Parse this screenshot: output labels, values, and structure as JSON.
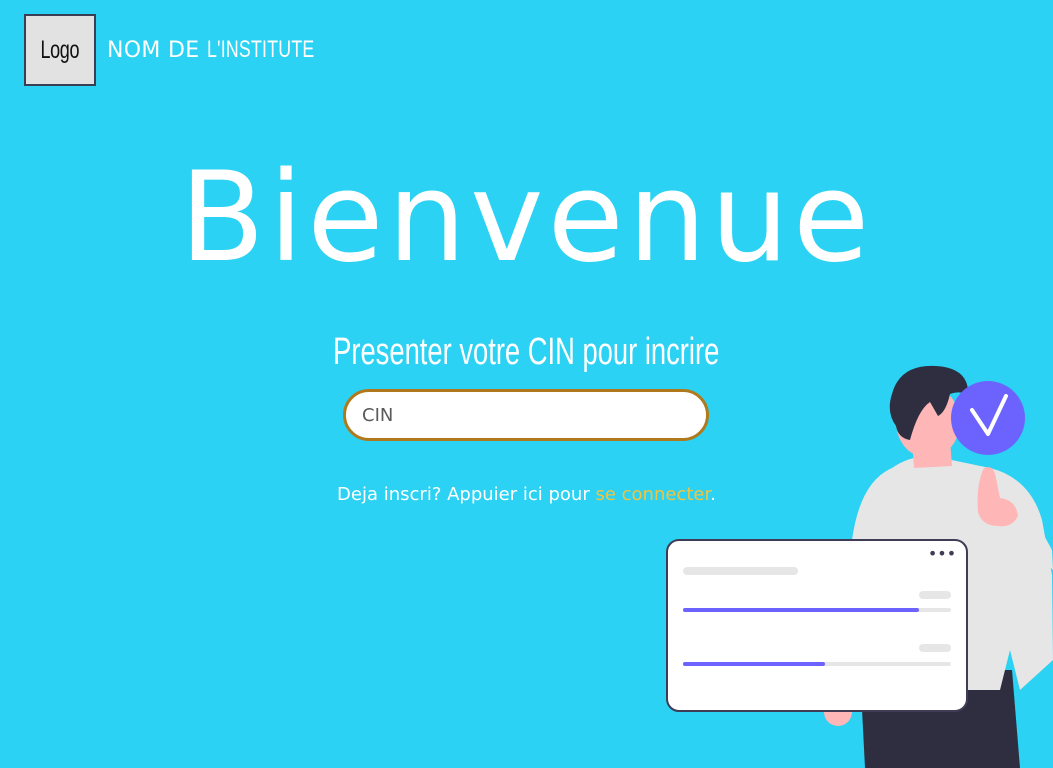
{
  "header": {
    "logo_label": "Logo",
    "institute_name_prefix": "NOM DE",
    "institute_name_suffix": "L'INSTITUTE"
  },
  "main": {
    "title": "Bienvenue",
    "subtitle": "Presenter votre CIN pour incrire",
    "cin_input": {
      "placeholder": "CIN",
      "value": ""
    },
    "login_prompt": "Deja inscri? Appuier ici pour",
    "login_link": "se connecter",
    "login_suffix": "."
  },
  "colors": {
    "background": "#2bd2f3",
    "accent_link": "#f1c440",
    "input_border": "#b07a1c",
    "check_badge": "#6c63ff"
  },
  "illustration": {
    "browser_dots": "•••",
    "progress_bars": [
      0.88,
      0.53
    ],
    "icons": [
      "check-icon",
      "more-dots-icon"
    ]
  }
}
